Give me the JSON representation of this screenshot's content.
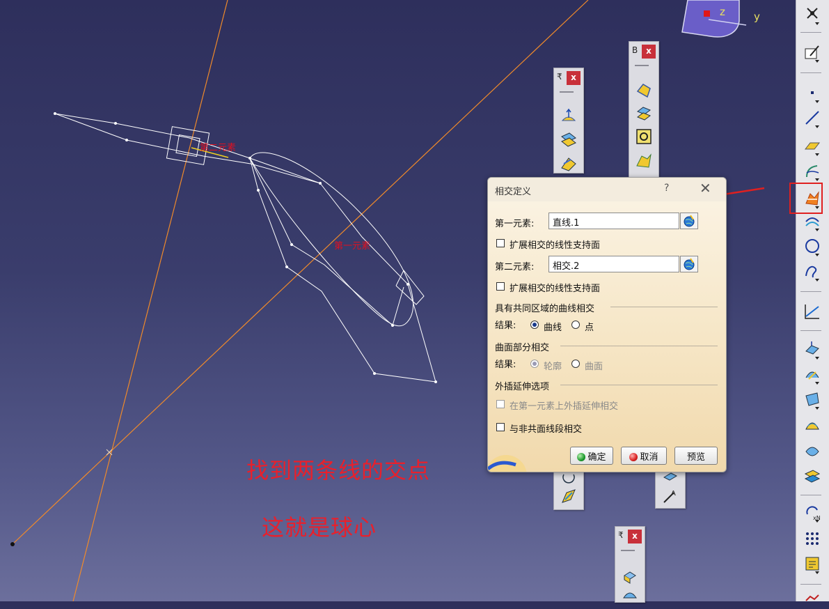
{
  "viewport": {
    "axis_labels": {
      "z": "z",
      "y": "y"
    },
    "geometry_labels": {
      "second_element": "第二元素",
      "first_element": "第一元素"
    },
    "annotations": {
      "line1": "找到两条线的交点",
      "line2": "这就是球心"
    }
  },
  "floating_toolbars": [
    {
      "title": "₹",
      "close": "x"
    },
    {
      "title": "B",
      "close": "x"
    },
    {
      "title": "₹",
      "close": "x"
    }
  ],
  "dialog": {
    "title": "相交定义",
    "help": "?",
    "close": "✕",
    "first_element": {
      "label": "第一元素:",
      "value": "直线.1"
    },
    "extend_first": "扩展相交的线性支持面",
    "second_element": {
      "label": "第二元素:",
      "value": "相交.2"
    },
    "extend_second": "扩展相交的线性支持面",
    "curve_section": {
      "title": "具有共同区域的曲线相交",
      "result_label": "结果:",
      "option_curve": "曲线",
      "option_point": "点",
      "selected": "曲线"
    },
    "surface_section": {
      "title": "曲面部分相交",
      "result_label": "结果:",
      "option_contour": "轮廓",
      "option_surface": "曲面",
      "selected": "轮廓"
    },
    "extrapolation_section": {
      "title": "外插延伸选项",
      "extrapolate_first": "在第一元素上外插延伸相交"
    },
    "intersect_non_coplanar": "与非共面线段相交",
    "buttons": {
      "ok": "确定",
      "cancel": "取消",
      "preview": "预览"
    }
  },
  "colors": {
    "construction_line": "#f08a2a",
    "wireframe": "#ffffff",
    "highlight": "#e02020",
    "dialog_bg": "#f6e6c6"
  }
}
